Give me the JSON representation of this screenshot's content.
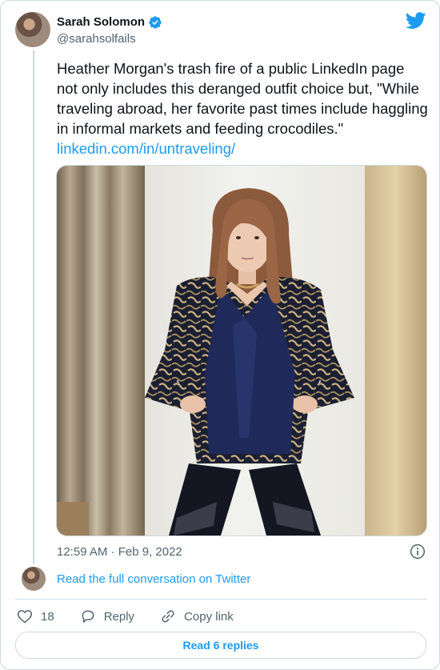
{
  "author": {
    "name": "Sarah Solomon",
    "handle": "@sarahsolfails",
    "verified": true
  },
  "tweet": {
    "text": "Heather Morgan's trash fire of a public LinkedIn page not only includes this deranged outfit choice but, \"While traveling abroad, her favorite past times include haggling in informal markets and feeding crocodiles.\" ",
    "link": "linkedin.com/in/untraveling/",
    "timestamp": "12:59 AM · Feb 9, 2022"
  },
  "conversation_link": "Read the full conversation on Twitter",
  "actions": {
    "like_count": "18",
    "reply_label": "Reply",
    "copy_link_label": "Copy link"
  },
  "read_replies_label": "Read 6 replies",
  "colors": {
    "accent": "#1d9bf0",
    "secondary_text": "#536471",
    "border": "#cfd9de"
  },
  "icons": [
    "verified-badge-icon",
    "twitter-bird-icon",
    "info-icon",
    "heart-icon",
    "reply-bubble-icon",
    "link-icon"
  ]
}
